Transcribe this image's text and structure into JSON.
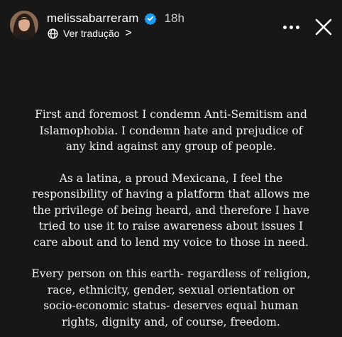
{
  "header": {
    "username": "melissabarreram",
    "time": "18h",
    "translate_label": "Ver tradução",
    "translate_chevron": ">"
  },
  "icons": {
    "verified": "verified-badge-icon",
    "globe": "globe-icon",
    "more": "more-dots-icon",
    "close": "close-icon"
  },
  "colors": {
    "background": "#171717",
    "text": "#f2f2f2",
    "verified_blue": "#1d9bf0"
  },
  "story": {
    "paragraphs": [
      "First and foremost I condemn Anti-Semitism and\nIslamophobia. I condemn hate and prejudice of\nany kind against any group of people.",
      "As a latina, a proud Mexicana, I feel the\nresponsibility of having a platform that allows me\nthe privilege of being heard, and therefore I have\ntried to use it to raise awareness about issues I\ncare about and to lend my voice to those in need.",
      "Every person on this earth- regardless of religion,\nrace, ethnicity, gender, sexual orientation or\nsocio-economic status- deserves equal human\nrights, dignity and, of course, freedom."
    ]
  }
}
